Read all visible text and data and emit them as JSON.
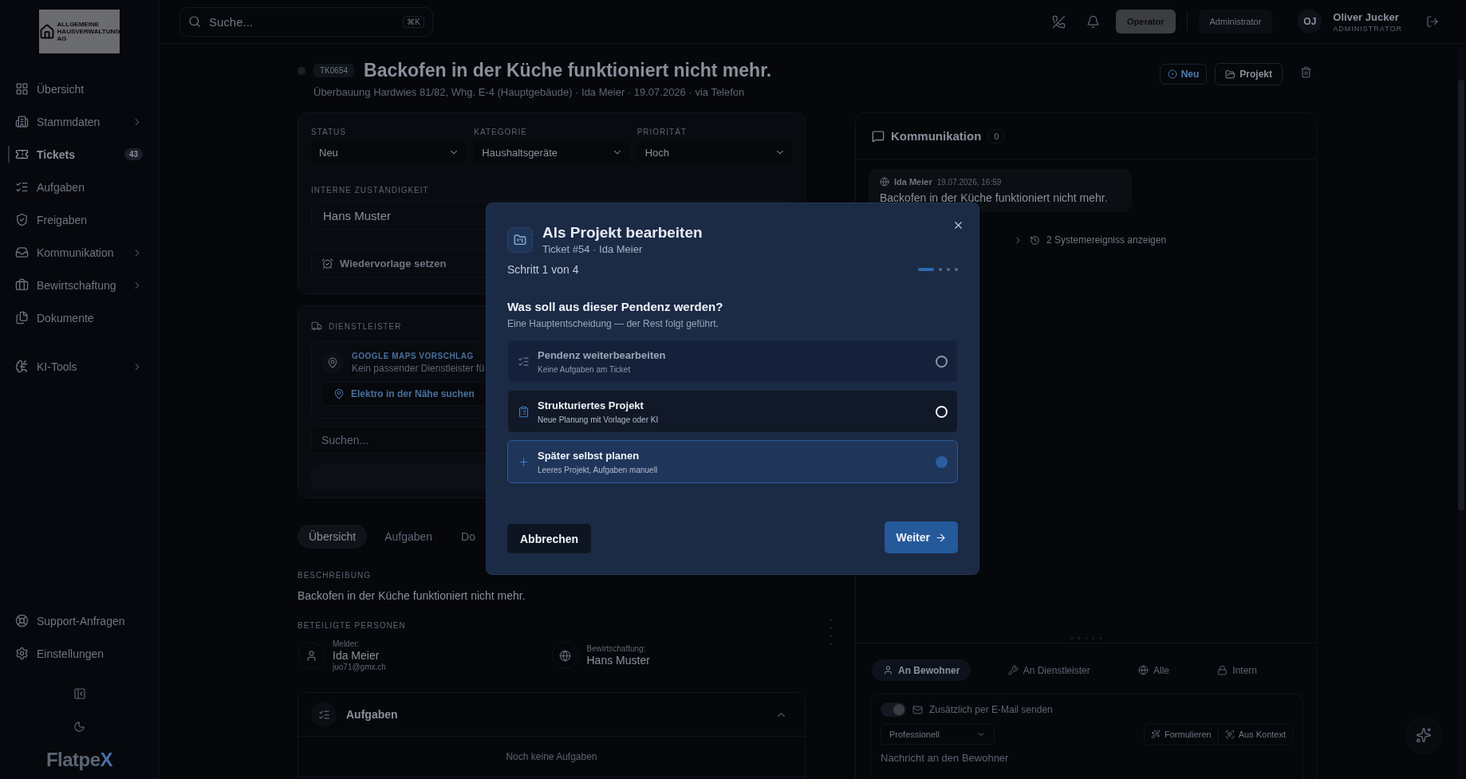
{
  "sidebar": {
    "logo": [
      "ALLGEMEINE",
      "HAUSVERWALTUNG",
      "AG"
    ],
    "nav": [
      {
        "label": "Übersicht",
        "selected": false,
        "expandable": false
      },
      {
        "label": "Stammdaten",
        "selected": false,
        "expandable": true
      },
      {
        "label": "Tickets",
        "selected": true,
        "expandable": false,
        "badge": "43"
      },
      {
        "label": "Aufgaben",
        "selected": false,
        "expandable": false
      },
      {
        "label": "Freigaben",
        "selected": false,
        "expandable": false
      },
      {
        "label": "Kommunikation",
        "selected": false,
        "expandable": true
      },
      {
        "label": "Bewirtschaftung",
        "selected": false,
        "expandable": true
      },
      {
        "label": "Dokumente",
        "selected": false,
        "expandable": false
      }
    ],
    "tools": [
      {
        "label": "KI-Tools",
        "selected": false,
        "expandable": true
      }
    ],
    "footer_nav": [
      {
        "label": "Support-Anfragen"
      },
      {
        "label": "Einstellungen"
      }
    ],
    "brand": {
      "name": "Flatpe",
      "accent": "X"
    }
  },
  "header": {
    "search": {
      "placeholder": "Suche...",
      "shortcut": "⌘K"
    },
    "roles": [
      {
        "label": "Operator",
        "selected": true
      },
      {
        "label": "Administrator",
        "selected": false
      }
    ],
    "user": {
      "initials": "OJ",
      "name": "Oliver Jucker",
      "role": "ADMINISTRATOR"
    }
  },
  "ticket": {
    "id": "TK0654",
    "title": "Backofen in der Küche funktioniert nicht mehr.",
    "meta": "Überbauung Hardwies 81/82, Whg. E-4 (Hauptgebäude) · Ida Meier · 19.07.2026 · via Telefon",
    "status_badge": "Neu",
    "project_button": "Projekt"
  },
  "fields": [
    {
      "label": "STATUS",
      "value": "Neu"
    },
    {
      "label": "KATEGORIE",
      "value": "Haushaltsgeräte"
    },
    {
      "label": "PRIORITÄT",
      "value": "Hoch"
    }
  ],
  "assignee": {
    "label": "INTERNE ZUSTÄNDIGKEIT",
    "value": "Hans Muster"
  },
  "reminder_button": "Wiedervorlage setzen",
  "provider": {
    "label": "DIENSTLEISTER",
    "suggestion_title": "GOOGLE MAPS VORSCHLAG",
    "suggestion_text": "Kein passender Dienstleister fü",
    "search_button": "Elektro in der Nähe suchen",
    "search": {
      "placeholder": "Suchen..."
    }
  },
  "tabs": [
    {
      "label": "Übersicht",
      "selected": true
    },
    {
      "label": "Aufgaben",
      "selected": false
    },
    {
      "label": "Do",
      "selected": false
    }
  ],
  "description": {
    "label": "BESCHREIBUNG",
    "text": "Backofen in der Küche funktioniert nicht mehr."
  },
  "people": {
    "label": "BETEILIGTE PERSONEN",
    "items": [
      {
        "role": "Melder:",
        "name": "Ida Meier",
        "email": "juo71@gmx.ch"
      },
      {
        "role": "Bewirtschaftung:",
        "name": "Hans Muster"
      }
    ]
  },
  "tasks": {
    "title": "Aufgaben",
    "expanded": true,
    "empty": "Noch keine Aufgaben"
  },
  "communication": {
    "title": "Kommunikation",
    "count": "0",
    "messages": [
      {
        "author": "Ida Meier",
        "time": "19.07.2026, 16:59",
        "text": "Backofen in der Küche funktioniert nicht mehr."
      }
    ],
    "system_events": "2 Systemereigniss anzeigen",
    "tabs": [
      {
        "label": "An Bewohner",
        "selected": true
      },
      {
        "label": "An Dienstleister",
        "selected": false
      },
      {
        "label": "Alle",
        "selected": false
      },
      {
        "label": "Intern",
        "selected": false
      }
    ],
    "composer": {
      "email_toggle": {
        "label": "Zusätzlich per E-Mail senden",
        "on": true
      },
      "tone": "Professionell",
      "actions": [
        "Formulieren",
        "Aus Kontext"
      ],
      "placeholder": "Nachricht an den Bewohner"
    }
  },
  "dialog": {
    "title": "Als Projekt bearbeiten",
    "subtitle": "Ticket #54 · Ida Meier",
    "step": "Schritt 1 von 4",
    "steps": [
      {
        "selected": true
      },
      {
        "selected": false
      },
      {
        "selected": false
      },
      {
        "selected": false
      }
    ],
    "question": "Was soll aus dieser Pendenz werden?",
    "hint": "Eine Hauptentscheidung — der Rest folgt geführt.",
    "options": [
      {
        "title": "Pendenz weiterbearbeiten",
        "text": "Keine Aufgaben am Ticket",
        "disabled": true,
        "selected": false
      },
      {
        "title": "Strukturiertes Projekt",
        "text": "Neue Planung mit Vorlage oder KI",
        "disabled": false,
        "selected": false
      },
      {
        "title": "Später selbst planen",
        "text": "Leeres Projekt, Aufgaben manuell",
        "disabled": false,
        "selected": true
      }
    ],
    "cancel": "Abbrechen",
    "next": "Weiter"
  }
}
